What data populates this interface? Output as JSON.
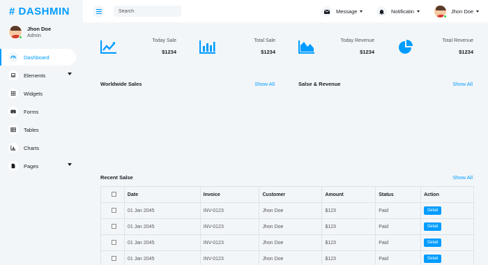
{
  "brand": {
    "name": "DASHMIN",
    "mark": "#"
  },
  "user": {
    "name": "Jhon Doe",
    "role": "Admin"
  },
  "sidebar": {
    "items": [
      {
        "label": "Dashboard",
        "icon": "speedometer-icon"
      },
      {
        "label": "Elements",
        "icon": "laptop-icon"
      },
      {
        "label": "Widgets",
        "icon": "grid-icon"
      },
      {
        "label": "Forms",
        "icon": "keyboard-icon"
      },
      {
        "label": "Tables",
        "icon": "table-icon"
      },
      {
        "label": "Charts",
        "icon": "chart-icon"
      },
      {
        "label": "Pages",
        "icon": "page-icon"
      }
    ]
  },
  "topbar": {
    "search_placeholder": "Search",
    "message_label": "Message",
    "notification_label": "Notificatin",
    "user_name": "Jhon Doe"
  },
  "stats": [
    {
      "label": "Today Sale",
      "value": "$1234",
      "icon": "line-chart-icon"
    },
    {
      "label": "Total Sale",
      "value": "$1234",
      "icon": "bar-chart-icon"
    },
    {
      "label": "Today Revenue",
      "value": "$1234",
      "icon": "area-chart-icon"
    },
    {
      "label": "Total Revenue",
      "value": "$1234",
      "icon": "pie-chart-icon"
    }
  ],
  "panels": {
    "worldwide": {
      "title": "Worldwide Sales",
      "link": "Show All"
    },
    "revenue": {
      "title": "Salse & Revenue",
      "link": "Show All"
    },
    "recent": {
      "title": "Recent Salse",
      "link": "Show All"
    }
  },
  "table": {
    "columns": [
      "Date",
      "Invoice",
      "Customer",
      "Amount",
      "Status",
      "Action"
    ],
    "rows": [
      {
        "date": "01 Jan 2045",
        "invoice": "INV-0123",
        "customer": "Jhon Doe",
        "amount": "$123",
        "status": "Paid",
        "action": "Detail"
      },
      {
        "date": "01 Jan 2045",
        "invoice": "INV-0123",
        "customer": "Jhon Doe",
        "amount": "$123",
        "status": "Paid",
        "action": "Detail"
      },
      {
        "date": "01 Jan 2045",
        "invoice": "INV-0123",
        "customer": "Jhon Doe",
        "amount": "$123",
        "status": "Paid",
        "action": "Detail"
      },
      {
        "date": "01 Jan 2045",
        "invoice": "INV-0123",
        "customer": "Jhon Doe",
        "amount": "$123",
        "status": "Paid",
        "action": "Detail"
      }
    ]
  },
  "colors": {
    "accent": "#009cff",
    "background": "#f3f6f9",
    "text": "#191c24"
  }
}
